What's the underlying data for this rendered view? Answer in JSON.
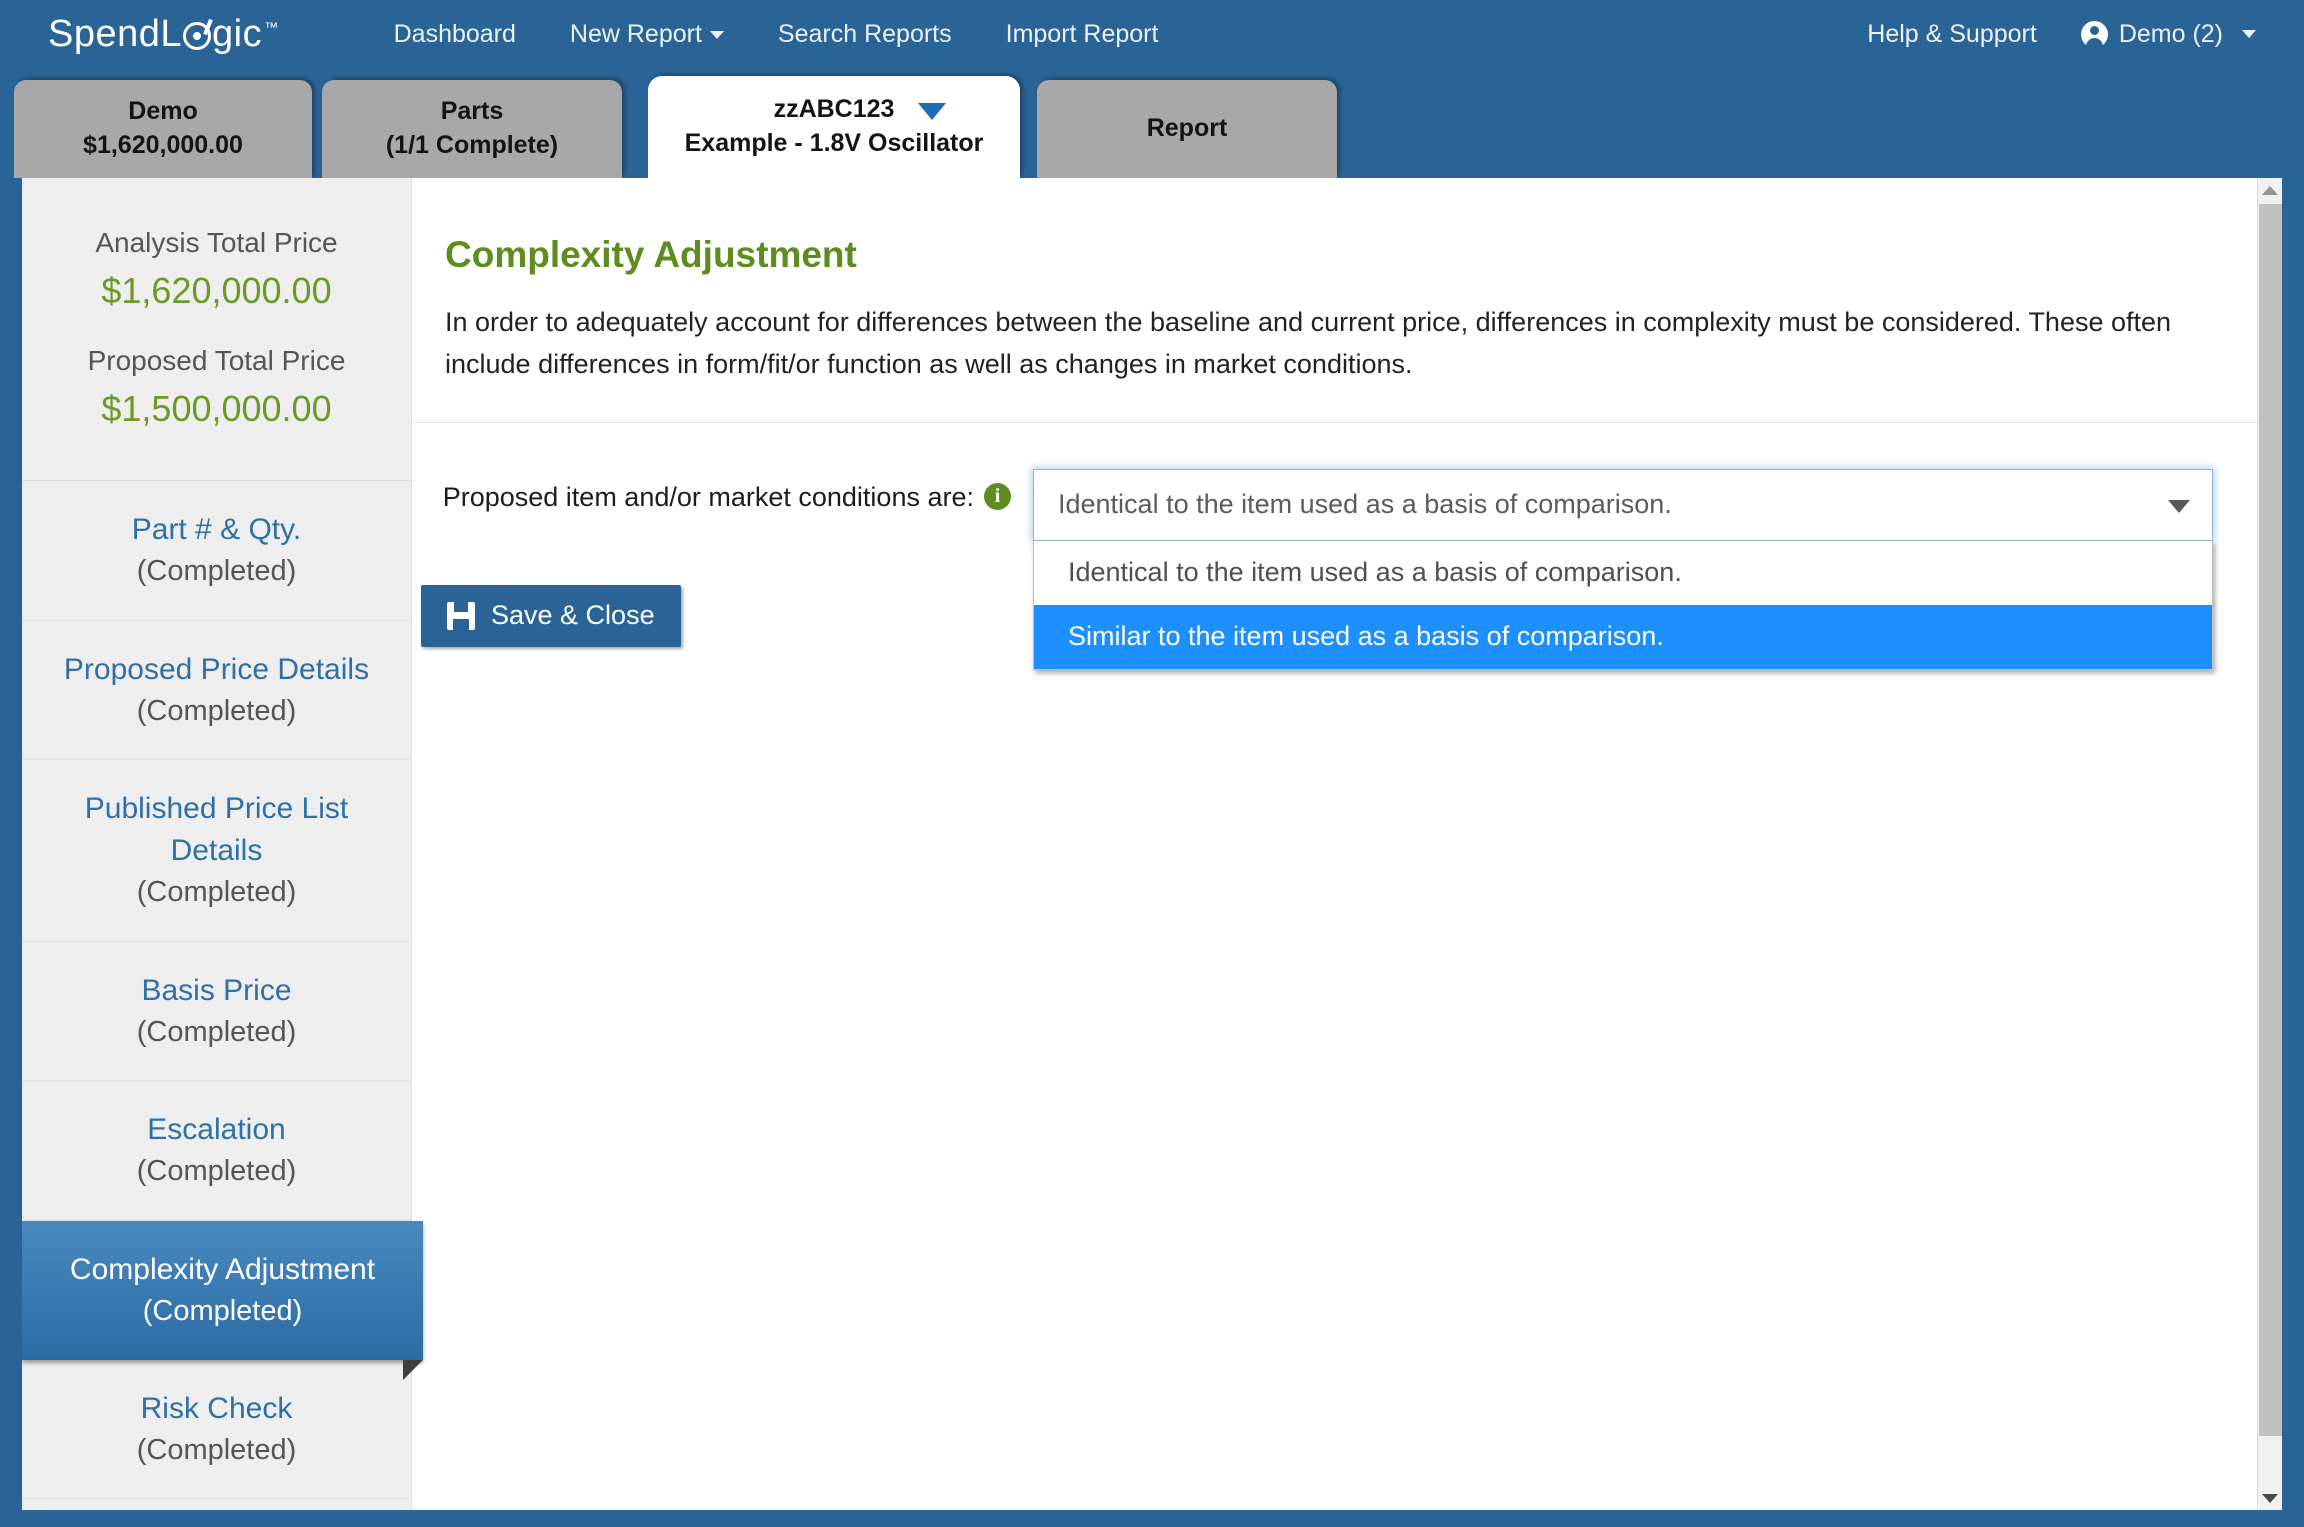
{
  "brand": {
    "part1": "Spend",
    "part2": "L",
    "part3": "gic",
    "tm": "™"
  },
  "topnav": {
    "links": [
      {
        "label": "Dashboard",
        "caret": false
      },
      {
        "label": "New Report",
        "caret": true
      },
      {
        "label": "Search Reports",
        "caret": false
      },
      {
        "label": "Import Report",
        "caret": false
      }
    ],
    "help_label": "Help & Support",
    "user_label": "Demo (2)"
  },
  "tabs": [
    {
      "line1": "Demo",
      "line2": "$1,620,000.00",
      "active": false,
      "caret": false
    },
    {
      "line1": "Parts",
      "line2": "(1/1 Complete)",
      "active": false,
      "caret": false
    },
    {
      "line1": "zzABC123",
      "line2": "Example - 1.8V Oscillator",
      "active": true,
      "caret": true
    },
    {
      "line1": "Report",
      "line2": "",
      "active": false,
      "caret": false
    }
  ],
  "sidebar": {
    "prices": [
      {
        "label": "Analysis Total Price",
        "value": "$1,620,000.00"
      },
      {
        "label": "Proposed Total Price",
        "value": "$1,500,000.00"
      }
    ],
    "items": [
      {
        "label": "Part # & Qty.",
        "status": "(Completed)",
        "active": false
      },
      {
        "label": "Proposed Price Details",
        "status": "(Completed)",
        "active": false
      },
      {
        "label": "Published Price List Details",
        "status": "(Completed)",
        "active": false
      },
      {
        "label": "Basis Price",
        "status": "(Completed)",
        "active": false
      },
      {
        "label": "Escalation",
        "status": "(Completed)",
        "active": false
      },
      {
        "label": "Complexity Adjustment",
        "status": "(Completed)",
        "active": true
      },
      {
        "label": "Risk Check",
        "status": "(Completed)",
        "active": false
      }
    ]
  },
  "main": {
    "title": "Complexity Adjustment",
    "description": "In order to adequately account for differences between the baseline and current price, differences in complexity must be considered. These often include differences in form/fit/or function as well as changes in market conditions.",
    "field_label": "Proposed item and/or market conditions are:",
    "info_icon_glyph": "i",
    "select": {
      "value": "Identical to the item used as a basis of comparison.",
      "expanded": true,
      "options": [
        {
          "label": "Identical to the item used as a basis of comparison.",
          "selected": false
        },
        {
          "label": "Similar to the item used as a basis of comparison.",
          "selected": true
        }
      ]
    },
    "save_button": "Save & Close"
  },
  "colors": {
    "brand_blue": "#2a6496",
    "accent_green": "#5e8c1f",
    "price_green": "#6d9a26",
    "link_blue": "#2f6fa6",
    "highlight_blue": "#1e8fff"
  }
}
